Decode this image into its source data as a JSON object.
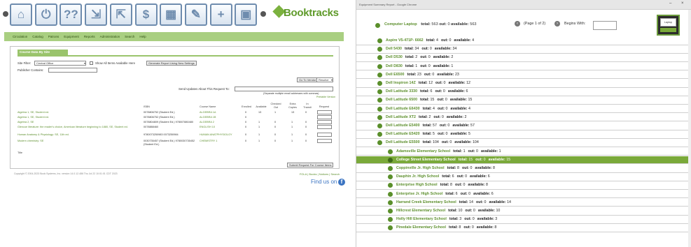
{
  "left": {
    "toolbar": {
      "icons": [
        "home-icon",
        "power-icon",
        "help-icon",
        "checkin-icon",
        "checkout-icon",
        "dollar-icon",
        "calculator-icon",
        "patron-edit-icon",
        "patron-add-icon",
        "calendar-icon"
      ],
      "icon_glyphs": [
        "⌂",
        "⏻",
        "??",
        "⇲",
        "⇱",
        "$",
        "▦",
        "✎",
        "+",
        "▣"
      ],
      "brand": "Booktracks"
    },
    "menu": [
      "Circulation",
      "Catalog",
      "Patrons",
      "Equipment",
      "Reports",
      "Administration",
      "Search",
      "Help"
    ],
    "panel_title": "Course Data By Site",
    "site_filter_label": "Site Filter:",
    "site_filter_value": "Central Office",
    "show_all_label": "Show All Items Available Here",
    "generate_btn": "Generate Report Using New Settings",
    "publisher_label": "Publisher Contains:",
    "to_vendor_btn": "Go To Vendor",
    "vendor_select": "Resolve",
    "send_updates_label": "Send Updates About This Request To:",
    "separate_note": "(Separate multiple email addresses with commas)",
    "printable_version": "Printable Version",
    "columns": {
      "title": "Title",
      "isbn": "ISBN",
      "course": "Course Name",
      "enrolled": "Enrolled",
      "available": "Available",
      "checked_out": "Checked Out",
      "extra": "Extra Copies",
      "in_transit": "In Transit",
      "request": "Request"
    },
    "rows": [
      {
        "title": "Algebra 1, SE, Student ed.",
        "isbn": "0078806752 (Student Ed.)",
        "course": "ALGEBRA 1A",
        "enrolled": "0",
        "available": "13",
        "checked_out": "1",
        "extra": "13",
        "in_transit": "0"
      },
      {
        "title": "Algebra 1, SE, Student ed.",
        "isbn": "0078806752 (Student Ed.)",
        "course": "ALGEBRA 1B",
        "enrolled": "0",
        "available": "",
        "checked_out": "",
        "extra": "",
        "in_transit": ""
      },
      {
        "title": "Algebra 2, SE",
        "isbn": "0078804809 (Student Ed.) 978007880480",
        "course": "ALGEBRA 2",
        "enrolled": "0",
        "available": "1",
        "checked_out": "0",
        "extra": "1",
        "in_transit": "0"
      },
      {
        "title": "Glencoe literature: the reader's choice, American literature beginning to 1880, SE, Student ed.",
        "isbn": "0078888460",
        "course": "ENGLISH 10",
        "enrolled": "0",
        "available": "1",
        "checked_out": "0",
        "extra": "1",
        "in_transit": "0"
      },
      {
        "title": "Human Anatomy & Physiology: SE, 11th ed.",
        "isbn": "9780073250983 0073250984",
        "course": "HUMAN ANATPHYSIOLGY",
        "enrolled": "0",
        "available": "1",
        "checked_out": "0",
        "extra": "1",
        "in_transit": "0"
      },
      {
        "title": "Modern chemistry: SE",
        "isbn": "0030735457 (Student Ed.) 9780030735452 (Student Ed.)",
        "course": "CHEMISTRY 1",
        "enrolled": "0",
        "available": "1",
        "checked_out": "0",
        "extra": "1",
        "in_transit": "0"
      }
    ],
    "submit_btn": "Submit Request For Course Items",
    "footer_left": "Copyright © 2004-2023 Book Systems, Inc. version 14.0.12.486 Thu Jul 22 10:01:01 CDT 2023",
    "footer_links": "FOLA | Books | Notices | Search",
    "find_us": "Find us on",
    "fb": "f"
  },
  "right": {
    "window_title": "Equipment Summary Report - Google Chrome",
    "win_min": "–",
    "win_close": "×",
    "header": {
      "name": "Computer Laptop",
      "total_label": "total:",
      "total": "563",
      "out_label": "out:",
      "out": "0",
      "available_label": "available:",
      "available": "563",
      "page_label": "(Page 1 of 2)",
      "begins_label": "Begins With:",
      "thumb_label": "Laptop"
    },
    "items": [
      {
        "name": "Aspire V5-471P- 6662",
        "total": "4",
        "out": "0",
        "available": "4",
        "level": 1
      },
      {
        "name": "Dell 5430",
        "total": "34",
        "out": "0",
        "available": "34",
        "level": 1
      },
      {
        "name": "Dell D530",
        "total": "2",
        "out": "0",
        "available": "2",
        "level": 1
      },
      {
        "name": "Dell D830",
        "total": "1",
        "out": "0",
        "available": "1",
        "level": 1
      },
      {
        "name": "Dell E6500",
        "total": "23",
        "out": "0",
        "available": "23",
        "level": 1
      },
      {
        "name": "Dell Inspiron 14Z",
        "total": "12",
        "out": "0",
        "available": "12",
        "level": 1
      },
      {
        "name": "Dell Latitude 3330",
        "total": "6",
        "out": "0",
        "available": "6",
        "level": 1
      },
      {
        "name": "Dell Latitude 6500",
        "total": "15",
        "out": "0",
        "available": "15",
        "level": 1
      },
      {
        "name": "Dell Latitude E6430",
        "total": "4",
        "out": "0",
        "available": "4",
        "level": 1
      },
      {
        "name": "Dell Latitude XT2",
        "total": "2",
        "out": "0",
        "available": "2",
        "level": 1
      },
      {
        "name": "Dell Latitude E5400",
        "total": "57",
        "out": "0",
        "available": "57",
        "level": 1
      },
      {
        "name": "Dell Latitude E5420",
        "total": "5",
        "out": "0",
        "available": "5",
        "level": 1
      },
      {
        "name": "Dell Latitude E5500",
        "total": "104",
        "out": "0",
        "available": "104",
        "level": 1
      },
      {
        "name": "Adamsville Elementary School",
        "total": "1",
        "out": "0",
        "available": "1",
        "level": 2
      },
      {
        "name": "College Street Elementary School",
        "total": "15",
        "out": "0",
        "available": "15",
        "level": 2,
        "highlight": true
      },
      {
        "name": "Coppinville Jr. High School",
        "total": "8",
        "out": "0",
        "available": "8",
        "level": 2
      },
      {
        "name": "Dauphin Jr. High School",
        "total": "6",
        "out": "0",
        "available": "6",
        "level": 2
      },
      {
        "name": "Enterprise High School",
        "total": "8",
        "out": "0",
        "available": "8",
        "level": 2
      },
      {
        "name": "Enterprise Jr. High School",
        "total": "6",
        "out": "0",
        "available": "6",
        "level": 2
      },
      {
        "name": "Harrand Creek Elementary School",
        "total": "14",
        "out": "0",
        "available": "14",
        "level": 2
      },
      {
        "name": "Hillcrest Elementary School",
        "total": "10",
        "out": "0",
        "available": "10",
        "level": 2
      },
      {
        "name": "Holly Hill Elementary School",
        "total": "3",
        "out": "0",
        "available": "3",
        "level": 2
      },
      {
        "name": "Pinedale Elementary School",
        "total": "8",
        "out": "0",
        "available": "8",
        "level": 2
      }
    ]
  },
  "colors": {
    "accent_green": "#7aa93a",
    "menu_green": "#a9cf81",
    "link_green": "#5d8f2d",
    "icon_blue": "#6e8cae"
  }
}
